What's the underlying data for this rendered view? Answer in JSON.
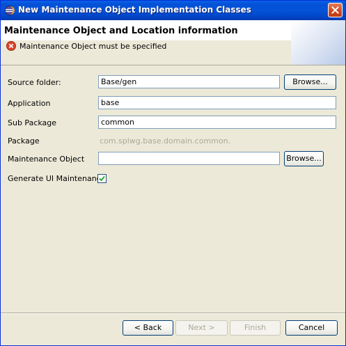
{
  "window": {
    "title": "New Maintenance Object Implementation Classes"
  },
  "header": {
    "title": "Maintenance Object and Location information",
    "message": "Maintenance Object must be specified"
  },
  "form": {
    "source_folder": {
      "label": "Source folder:",
      "value": "Base/gen",
      "browse": "Browse..."
    },
    "application": {
      "label": "Application",
      "value": "base"
    },
    "sub_package": {
      "label": "Sub Package",
      "value": "common"
    },
    "package": {
      "label": "Package",
      "value": "com.splwg.base.domain.common."
    },
    "maintenance_object": {
      "label": "Maintenance Object",
      "value": "",
      "browse": "Browse..."
    },
    "generate_ui": {
      "label": "Generate UI Maintenance",
      "checked": true
    }
  },
  "buttons": {
    "back": "< Back",
    "next": "Next >",
    "finish": "Finish",
    "cancel": "Cancel"
  },
  "colors": {
    "titlebar": "#0453d8",
    "dialog_bg": "#ece9d8",
    "error": "#d9462b",
    "disabled_text": "#aca899"
  }
}
